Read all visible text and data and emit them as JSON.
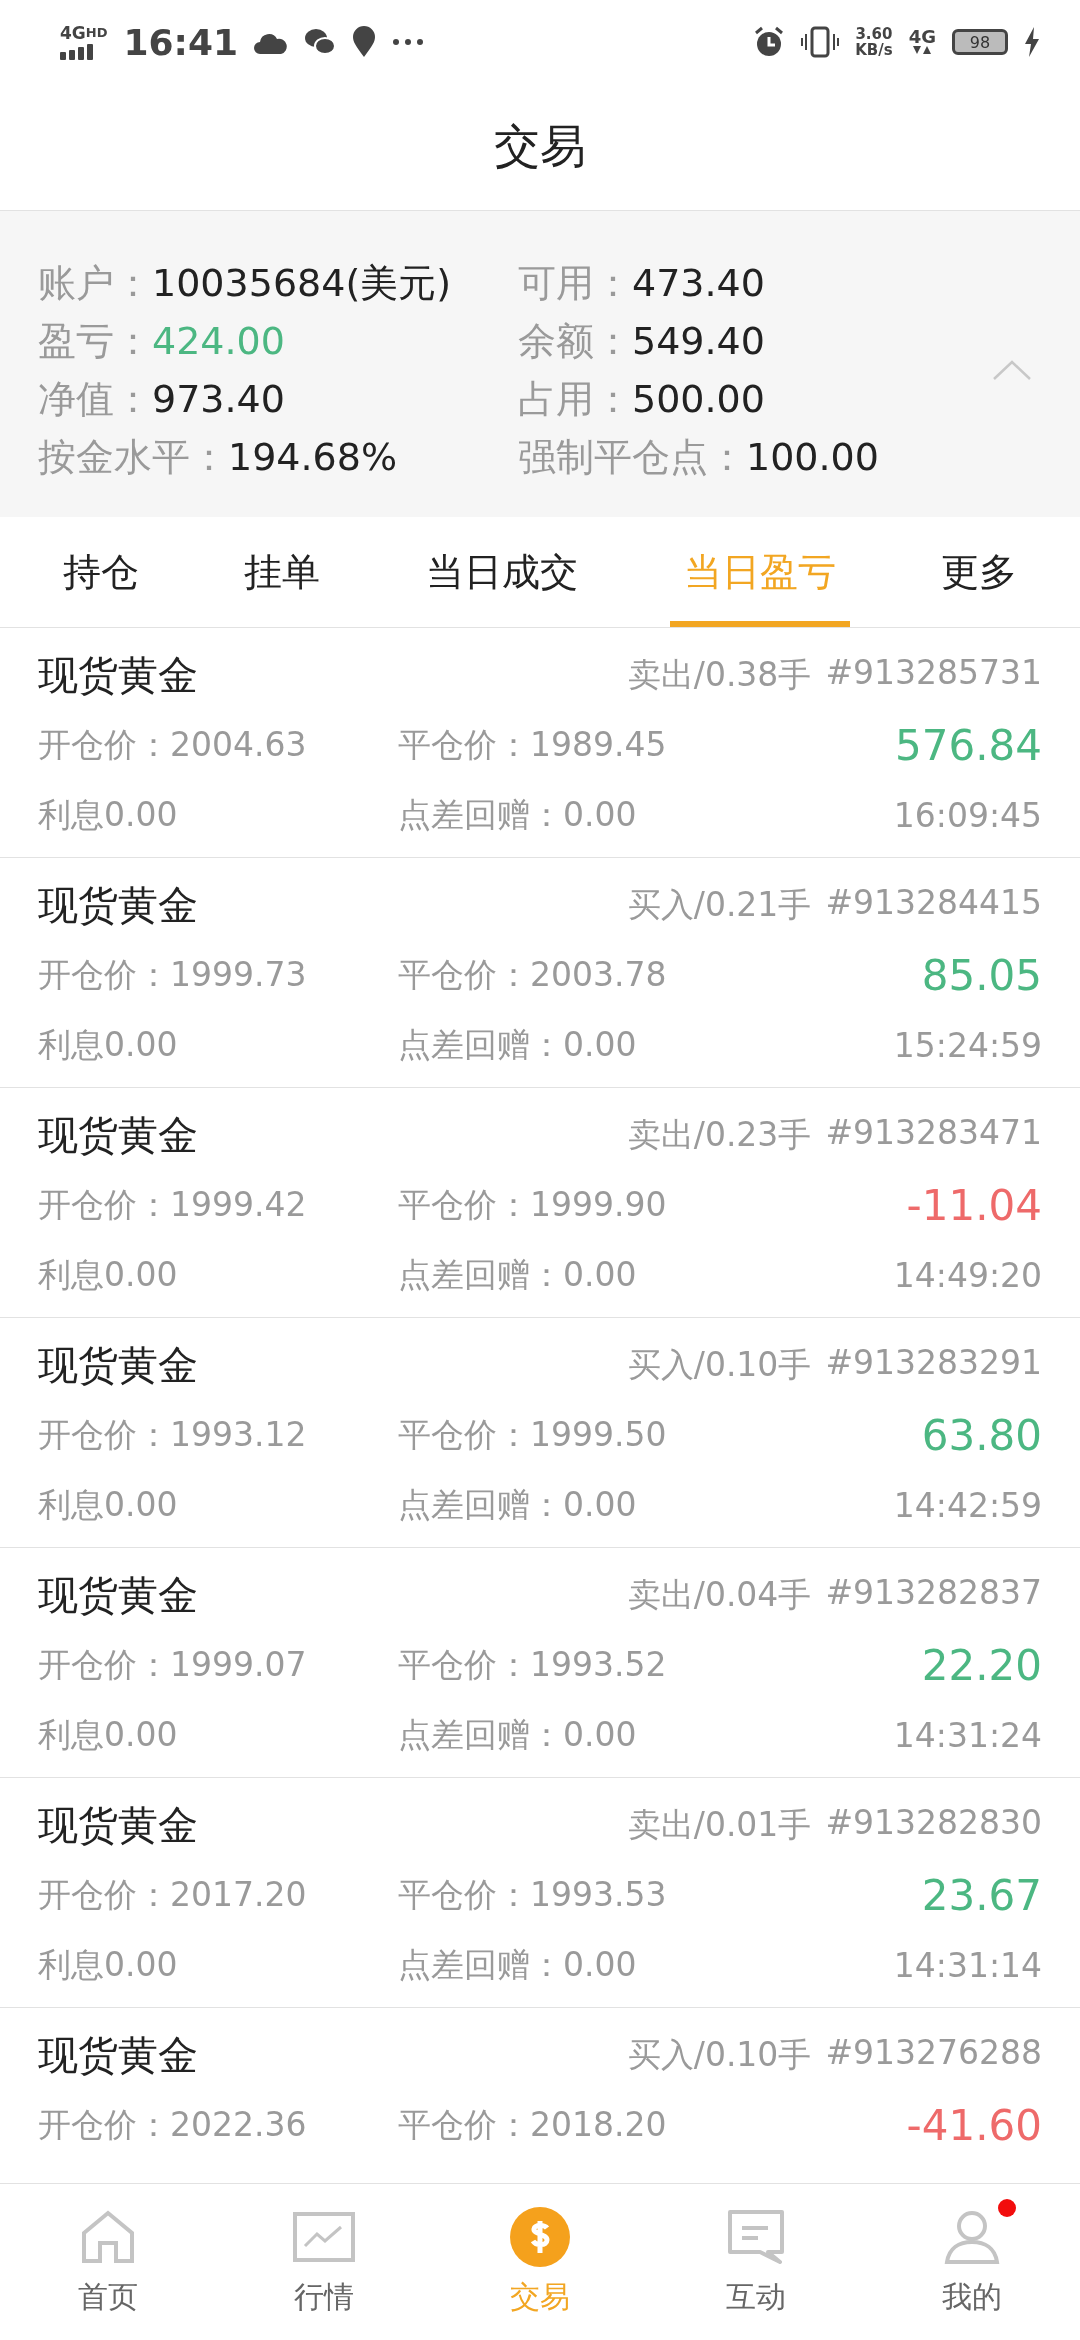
{
  "status_bar": {
    "network": "4G",
    "network_sub": "HD",
    "time": "16:41",
    "speed": "3.60",
    "speed_unit": "KB/s",
    "data_type": "4G",
    "battery": "98"
  },
  "header": {
    "title": "交易"
  },
  "account": {
    "expanded": true,
    "fields": [
      {
        "label": "账户：",
        "value": "10035684(美元)",
        "color": "#222222"
      },
      {
        "label": "可用：",
        "value": "473.40",
        "color": "#222222"
      },
      {
        "label": "盈亏：",
        "value": "424.00",
        "color": "#4cb782"
      },
      {
        "label": "余额：",
        "value": "549.40",
        "color": "#222222"
      },
      {
        "label": "净值：",
        "value": "973.40",
        "color": "#222222"
      },
      {
        "label": "占用：",
        "value": "500.00",
        "color": "#222222"
      },
      {
        "label": "按金水平：",
        "value": "194.68%",
        "color": "#222222"
      },
      {
        "label": "强制平仓点：",
        "value": "100.00",
        "color": "#222222"
      }
    ]
  },
  "tabs": [
    {
      "label": "持仓",
      "selected": false
    },
    {
      "label": "挂单",
      "selected": false
    },
    {
      "label": "当日成交",
      "selected": false
    },
    {
      "label": "当日盈亏",
      "selected": true
    },
    {
      "label": "更多",
      "selected": false
    }
  ],
  "trades": [
    {
      "name": "现货黄金",
      "side": "卖出/0.38手",
      "ticket": "#913285731",
      "open": "开仓价：2004.63",
      "close": "平仓价：1989.45",
      "profit": "576.84",
      "color": "#4cb782",
      "interest": "利息0.00",
      "rebate": "点差回赠：0.00",
      "time": "16:09:45"
    },
    {
      "name": "现货黄金",
      "side": "买入/0.21手",
      "ticket": "#913284415",
      "open": "开仓价：1999.73",
      "close": "平仓价：2003.78",
      "profit": "85.05",
      "color": "#4cb782",
      "interest": "利息0.00",
      "rebate": "点差回赠：0.00",
      "time": "15:24:59"
    },
    {
      "name": "现货黄金",
      "side": "卖出/0.23手",
      "ticket": "#913283471",
      "open": "开仓价：1999.42",
      "close": "平仓价：1999.90",
      "profit": "-11.04",
      "color": "#ee6a6a",
      "interest": "利息0.00",
      "rebate": "点差回赠：0.00",
      "time": "14:49:20"
    },
    {
      "name": "现货黄金",
      "side": "买入/0.10手",
      "ticket": "#913283291",
      "open": "开仓价：1993.12",
      "close": "平仓价：1999.50",
      "profit": "63.80",
      "color": "#4cb782",
      "interest": "利息0.00",
      "rebate": "点差回赠：0.00",
      "time": "14:42:59"
    },
    {
      "name": "现货黄金",
      "side": "卖出/0.04手",
      "ticket": "#913282837",
      "open": "开仓价：1999.07",
      "close": "平仓价：1993.52",
      "profit": "22.20",
      "color": "#4cb782",
      "interest": "利息0.00",
      "rebate": "点差回赠：0.00",
      "time": "14:31:24"
    },
    {
      "name": "现货黄金",
      "side": "卖出/0.01手",
      "ticket": "#913282830",
      "open": "开仓价：2017.20",
      "close": "平仓价：1993.53",
      "profit": "23.67",
      "color": "#4cb782",
      "interest": "利息0.00",
      "rebate": "点差回赠：0.00",
      "time": "14:31:14"
    },
    {
      "name": "现货黄金",
      "side": "买入/0.10手",
      "ticket": "#913276288",
      "open": "开仓价：2022.36",
      "close": "平仓价：2018.20",
      "profit": "-41.60",
      "color": "#ee6a6a"
    }
  ],
  "nav": [
    {
      "label": "首页",
      "kind": "home",
      "selected": false,
      "badge": false
    },
    {
      "label": "行情",
      "kind": "chart",
      "selected": false,
      "badge": false
    },
    {
      "label": "交易",
      "kind": "trade",
      "selected": true,
      "badge": false
    },
    {
      "label": "互动",
      "kind": "chat",
      "selected": false,
      "badge": false
    },
    {
      "label": "我的",
      "kind": "user",
      "selected": false,
      "badge": true
    }
  ]
}
